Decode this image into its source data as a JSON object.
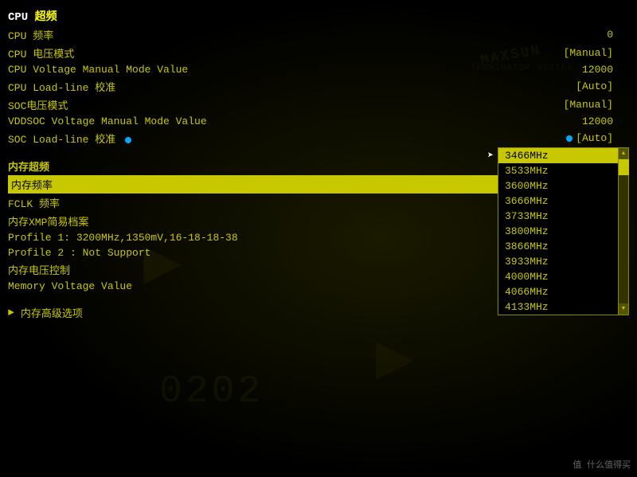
{
  "bios": {
    "cpu_section": {
      "title_static": "CPU ",
      "title_highlight": "超频",
      "rows": [
        {
          "label": "CPU 频率",
          "value": "0"
        },
        {
          "label": "CPU 电压模式",
          "value": "[Manual]"
        },
        {
          "label": "CPU Voltage Manual Mode Value",
          "value": "12000"
        },
        {
          "label": "CPU Load-line 校准",
          "value": "[Auto]"
        },
        {
          "label": "SOC电压模式",
          "value": "[Manual]"
        },
        {
          "label": "VDDSOC Voltage Manual Mode Value",
          "value": "12000"
        },
        {
          "label": "SOC Load-line 校准",
          "value": "[Auto]",
          "has_dots": true
        }
      ]
    },
    "mem_section": {
      "title": "内存超频",
      "rows": [
        {
          "label": "内存频率",
          "value": "[3466MHz]",
          "selected": true
        },
        {
          "label": "FCLK 频率",
          "value": ""
        },
        {
          "label": "内存XMP简易档案",
          "value": ""
        }
      ],
      "profiles": [
        {
          "text": "Profile 1: 3200MHz,1350mV,16-18-18-38"
        },
        {
          "text": "Profile 2 : Not Support"
        }
      ],
      "extra_rows": [
        {
          "label": "内存电压控制",
          "value": ""
        },
        {
          "label": "Memory Voltage Value",
          "value": ""
        }
      ]
    },
    "advanced_section": {
      "label": "内存高级选项"
    },
    "dropdown": {
      "items": [
        {
          "label": "3466MHz",
          "active": true
        },
        {
          "label": "3533MHz",
          "active": false
        },
        {
          "label": "3600MHz",
          "active": false
        },
        {
          "label": "3666MHz",
          "active": false
        },
        {
          "label": "3733MHz",
          "active": false
        },
        {
          "label": "3800MHz",
          "active": false
        },
        {
          "label": "3866MHz",
          "active": false
        },
        {
          "label": "3933MHz",
          "active": false
        },
        {
          "label": "4000MHz",
          "active": false
        },
        {
          "label": "4066MHz",
          "active": false
        },
        {
          "label": "4133MHz",
          "active": false
        }
      ]
    },
    "watermark": {
      "brand": "MAXSUN",
      "sub": "TERMINATOR SERIES",
      "number": "0202",
      "bottom_right": "值 什么值得买"
    }
  }
}
